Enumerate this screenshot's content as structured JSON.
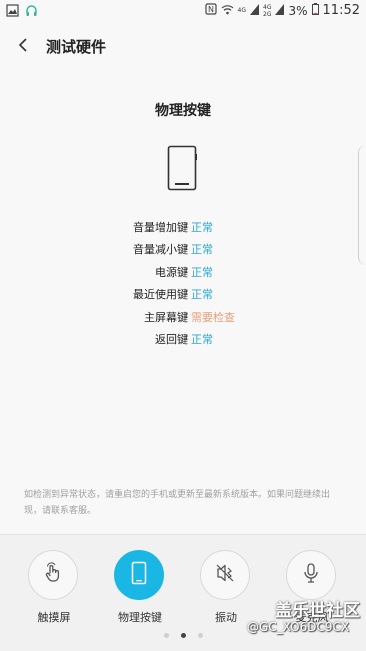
{
  "status_bar": {
    "battery": "3%",
    "time": "11:52",
    "net_top": "4G",
    "net_lte": "4G",
    "net_2g": "2G"
  },
  "header": {
    "title": "测试硬件"
  },
  "section": {
    "title": "物理按键"
  },
  "results": [
    {
      "label": "音量增加键",
      "value": "正常",
      "status": "ok"
    },
    {
      "label": "音量减小键",
      "value": "正常",
      "status": "ok"
    },
    {
      "label": "电源键",
      "value": "正常",
      "status": "ok"
    },
    {
      "label": "最近使用键",
      "value": "正常",
      "status": "ok"
    },
    {
      "label": "主屏幕键",
      "value": "需要检查",
      "status": "warn"
    },
    {
      "label": "返回键",
      "value": "正常",
      "status": "ok"
    }
  ],
  "separator": ":",
  "notice": "如检测到异常状态，请重启您的手机或更新至最新系统版本。如果问题继续出现，请联系客服。",
  "tabs": [
    {
      "label": "触摸屏",
      "icon": "touch-icon"
    },
    {
      "label": "物理按键",
      "icon": "phone-icon",
      "active": true
    },
    {
      "label": "振动",
      "icon": "vibrate-off-icon"
    },
    {
      "label": "麦克风",
      "icon": "microphone-icon"
    }
  ],
  "pager": {
    "pages": 3,
    "current": 2
  },
  "watermark": {
    "brand": "盖乐世社区",
    "user": "@GC_XO6DC9CX"
  },
  "colors": {
    "accent": "#1ab6e4",
    "ok": "#2aa6d8",
    "warn": "#e8a07a"
  }
}
